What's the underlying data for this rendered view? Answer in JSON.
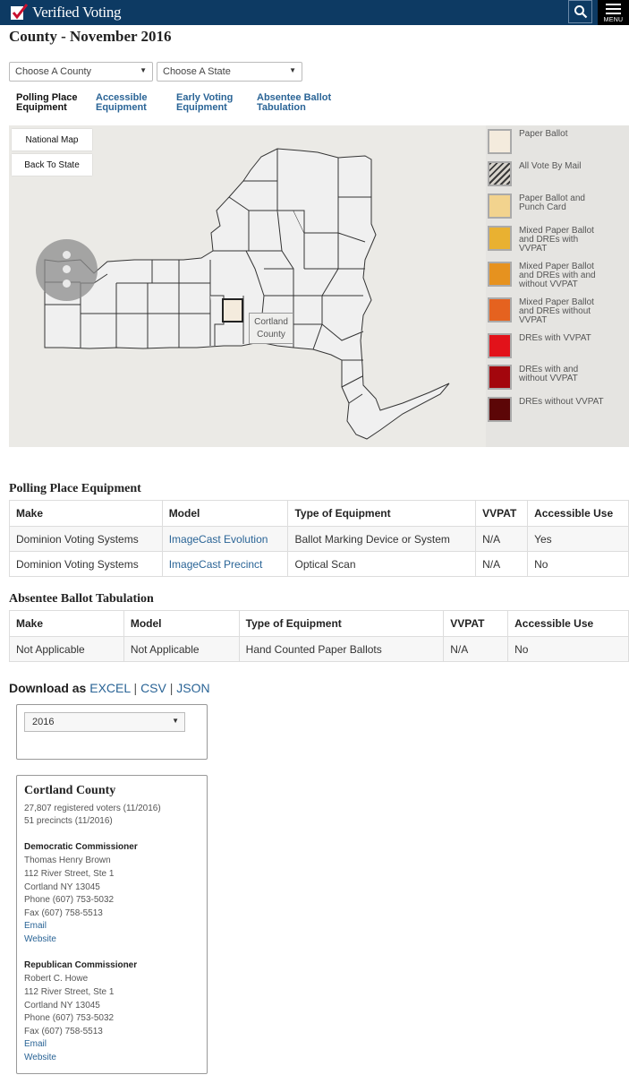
{
  "header": {
    "brand": "Verified Voting",
    "menu_label": "MENU",
    "search_icon": "search-icon",
    "menu_icon": "hamburger-icon"
  },
  "page": {
    "title": "County - November 2016"
  },
  "filters": {
    "county_placeholder": "Choose A County",
    "state_placeholder": "Choose A State"
  },
  "tabs": [
    {
      "line1": "Polling Place",
      "line2": "Equipment",
      "active": true
    },
    {
      "line1": "Accessible",
      "line2": "Equipment",
      "active": false
    },
    {
      "line1": "Early Voting",
      "line2": "Equipment",
      "active": false
    },
    {
      "line1": "Absentee Ballot",
      "line2": "Tabulation",
      "active": false
    }
  ],
  "map": {
    "national_btn": "National Map",
    "back_btn": "Back To State",
    "tooltip_line1": "Cortland",
    "tooltip_line2": "County",
    "legend": [
      {
        "label": "Paper Ballot",
        "color": "#f4ebdd"
      },
      {
        "label": "All Vote By Mail",
        "color": "hatch"
      },
      {
        "label": "Paper Ballot and Punch Card",
        "color": "#f2d38e"
      },
      {
        "label": "Mixed Paper Ballot and DREs with VVPAT",
        "color": "#e9b131"
      },
      {
        "label": "Mixed Paper Ballot and DREs with and without VVPAT",
        "color": "#e6921f"
      },
      {
        "label": "Mixed Paper Ballot and DREs without VVPAT",
        "color": "#e5621f"
      },
      {
        "label": "DREs with VVPAT",
        "color": "#e2121a"
      },
      {
        "label": "DREs with and without VVPAT",
        "color": "#a3060d"
      },
      {
        "label": "DREs without VVPAT",
        "color": "#5c0607"
      }
    ]
  },
  "polling": {
    "heading": "Polling Place Equipment",
    "columns": [
      "Make",
      "Model",
      "Type of Equipment",
      "VVPAT",
      "Accessible Use"
    ],
    "rows": [
      [
        "Dominion Voting Systems",
        "ImageCast Evolution",
        "Ballot Marking Device or System",
        "N/A",
        "Yes"
      ],
      [
        "Dominion Voting Systems",
        "ImageCast Precinct",
        "Optical Scan",
        "N/A",
        "No"
      ]
    ]
  },
  "absentee": {
    "heading": "Absentee Ballot Tabulation",
    "columns": [
      "Make",
      "Model",
      "Type of Equipment",
      "VVPAT",
      "Accessible Use"
    ],
    "rows": [
      [
        "Not Applicable",
        "Not Applicable",
        "Hand Counted Paper Ballots",
        "N/A",
        "No"
      ]
    ]
  },
  "download": {
    "label": "Download as",
    "excel": "EXCEL",
    "csv": "CSV",
    "json": "JSON",
    "sep": "|"
  },
  "year": {
    "selected": "2016"
  },
  "county": {
    "name": "Cortland County",
    "voters": "27,807 registered voters (11/2016)",
    "precincts": "51 precincts (11/2016)",
    "dem": {
      "title": "Democratic Commissioner",
      "name": "Thomas Henry Brown",
      "address1": "112 River Street, Ste 1",
      "address2": "Cortland NY 13045",
      "phone": "Phone (607) 753-5032",
      "fax": "Fax (607) 758-5513",
      "email": "Email",
      "website": "Website"
    },
    "rep": {
      "title": "Republican Commissioner",
      "name": "Robert C. Howe",
      "address1": "112 River Street, Ste 1",
      "address2": "Cortland NY 13045",
      "phone": "Phone (607) 753-5032",
      "fax": "Fax (607) 758-5513",
      "email": "Email",
      "website": "Website"
    }
  }
}
